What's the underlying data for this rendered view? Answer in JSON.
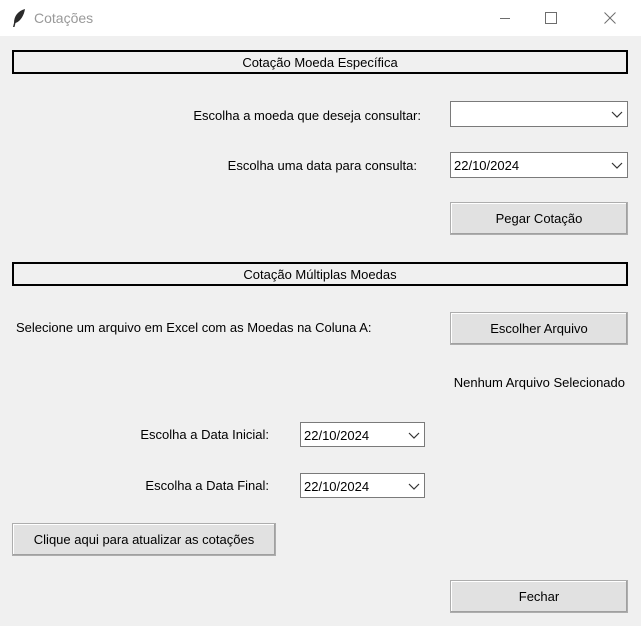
{
  "window": {
    "title": "Cotações",
    "app_icon": "feather-icon",
    "controls": [
      "minimize-icon",
      "maximize-icon",
      "close-icon"
    ]
  },
  "section_single": {
    "header": "Cotação Moeda Específica",
    "currency_label": "Escolha a moeda que deseja consultar:",
    "currency_value": "",
    "date_label": "Escolha uma data para consulta:",
    "date_value": "22/10/2024",
    "get_button": "Pegar Cotação"
  },
  "section_multi": {
    "header": "Cotação Múltiplas Moedas",
    "file_label": "Selecione um arquivo em Excel com as Moedas na Coluna A:",
    "file_button": "Escolher Arquivo",
    "file_status": "Nenhum Arquivo Selecionado",
    "start_label": "Escolha a Data Inicial:",
    "start_value": "22/10/2024",
    "end_label": "Escolha a Data Final:",
    "end_value": "22/10/2024",
    "update_button": "Clique aqui para atualizar as cotações"
  },
  "close_button": "Fechar"
}
